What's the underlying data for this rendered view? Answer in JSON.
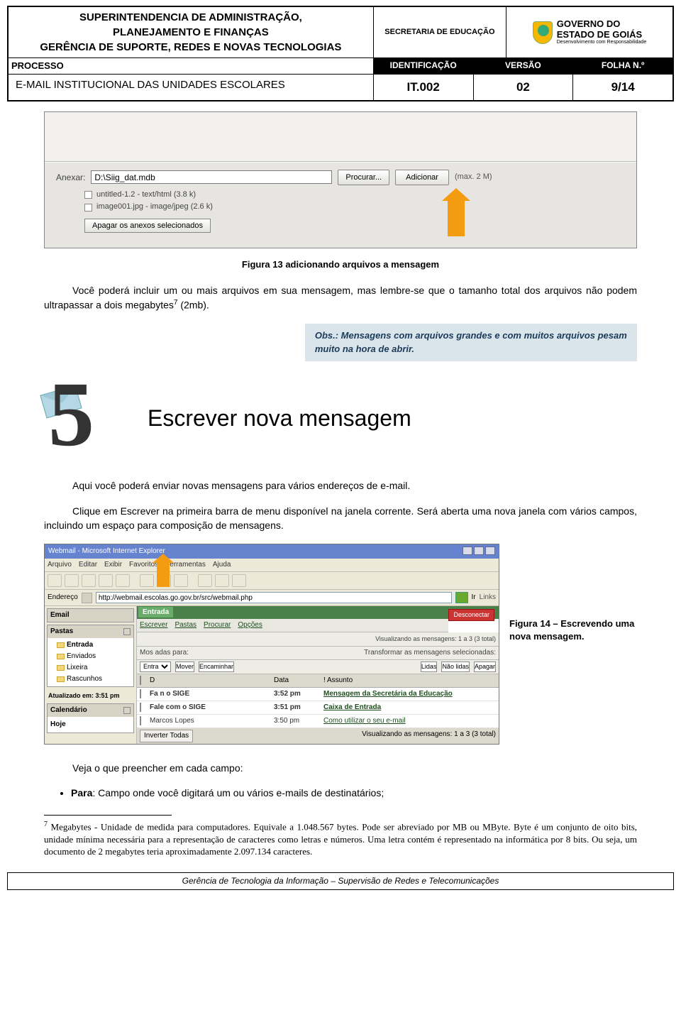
{
  "header": {
    "org_line1": "SUPERINTENDENCIA DE ADMINISTRAÇÃO,",
    "org_line2": "PLANEJAMENTO E FINANÇAS",
    "org_line3": "GERÊNCIA DE SUPORTE, REDES E NOVAS TECNOLOGIAS",
    "secretaria": "SECRETARIA DE EDUCAÇÃO",
    "gov1": "GOVERNO DO",
    "gov2": "ESTADO DE GOIÁS",
    "gov3": "Desenvolvimento com Responsabilidade",
    "processo": "PROCESSO",
    "lbl_id": "IDENTIFICAÇÃO",
    "lbl_ver": "VERSÃO",
    "lbl_folha": "FOLHA N.º",
    "title": "E-MAIL INSTITUCIONAL DAS UNIDADES ESCOLARES",
    "val_id": "IT.002",
    "val_ver": "02",
    "val_folha": "9/14"
  },
  "shot1": {
    "anexar": "Anexar:",
    "input_val": "D:\\Siig_dat.mdb",
    "procurar": "Procurar...",
    "adicionar": "Adicionar",
    "max": "(max. 2 M)",
    "file1": "untitled-1.2 - text/html (3.8 k)",
    "file2": "image001.jpg - image/jpeg (2.6 k)",
    "apagar": "Apagar os anexos selecionados"
  },
  "fig13_cap": "Figura 13 adicionando arquivos a mensagem",
  "p1": "Você poderá incluir um ou mais arquivos em sua mensagem, mas lembre-se que o tamanho total dos arquivos não podem ultrapassar a dois megabytes",
  "p1b": " (2mb).",
  "sup7": "7",
  "obs": "Obs.: Mensagens com arquivos grandes e com muitos arquivos pesam muito na hora de abrir.",
  "sec5_title": "Escrever nova mensagem",
  "p2": "Aqui você poderá enviar novas mensagens para vários endereços de e-mail.",
  "p3": "Clique em Escrever na primeira barra de menu disponível na janela corrente. Será aberta uma nova janela com vários campos, incluindo um espaço para composição de mensagens.",
  "shot2": {
    "title": "Webmail - Microsoft Internet Explorer",
    "menus": [
      "Arquivo",
      "Editar",
      "Exibir",
      "Favoritos",
      "Ferramentas",
      "Ajuda"
    ],
    "addr_lbl": "Endereço",
    "addr_val": "http://webmail.escolas.go.gov.br/src/webmail.php",
    "ir": "Ir",
    "links": "Links",
    "sb_email": "Email",
    "sb_pastas": "Pastas",
    "folders": [
      "Entrada",
      "Enviados",
      "Lixeira",
      "Rascunhos"
    ],
    "atual": "Atualizado em: 3:51 pm",
    "cal": "Calendário",
    "hoje": "Hoje",
    "entrada": "Entrada",
    "desconectar": "Desconectar",
    "acts": [
      "Escrever",
      "Pastas",
      "Procurar",
      "Opções"
    ],
    "vis1": "Visualizando as mensagens: 1 a 3 (3 total)",
    "trans": "Transformar as mensagens selecionadas:",
    "mover_lbl": "Mos     adas para:",
    "entra": "Entra",
    "mover": "Mover",
    "encaminhar": "Encaminhar",
    "lidas": "Lidas",
    "naolidas": "Não lidas",
    "apag": "Apagar",
    "hD": "D",
    "hData": "Data",
    "hAss": "Assunto",
    "rows": [
      {
        "de": "Fa            n o SIGE",
        "data": "3:52 pm",
        "ass": "Mensagem da Secretária da Educação"
      },
      {
        "de": "Fale com o SIGE",
        "data": "3:51 pm",
        "ass": "Caixa de Entrada"
      },
      {
        "de": "Marcos Lopes",
        "data": "3:50 pm",
        "ass": "Como utilizar o seu e-mail"
      }
    ],
    "inverter": "Inverter Todas",
    "vis2": "Visualizando as mensagens: 1 a 3 (3 total)"
  },
  "fig14": "Figura 14 – Escrevendo uma nova mensagem.",
  "p4": "Veja o que preencher em cada campo:",
  "bullet1a": "Para",
  "bullet1b": ": Campo onde você digitará um ou vários e-mails de destinatários;",
  "footnote": "Megabytes - Unidade de medida para computadores. Equivale a 1.048.567 bytes. Pode ser abreviado por MB ou MByte. Byte é um conjunto de oito bits, unidade mínima necessária para a representação de caracteres como letras e números. Uma letra contém é representado na informática por 8 bits. Ou seja, um documento de 2 megabytes teria aproximadamente 2.097.134 caracteres.",
  "pg_footer": "Gerência de Tecnologia da Informação – Supervisão de Redes e Telecomunicações"
}
